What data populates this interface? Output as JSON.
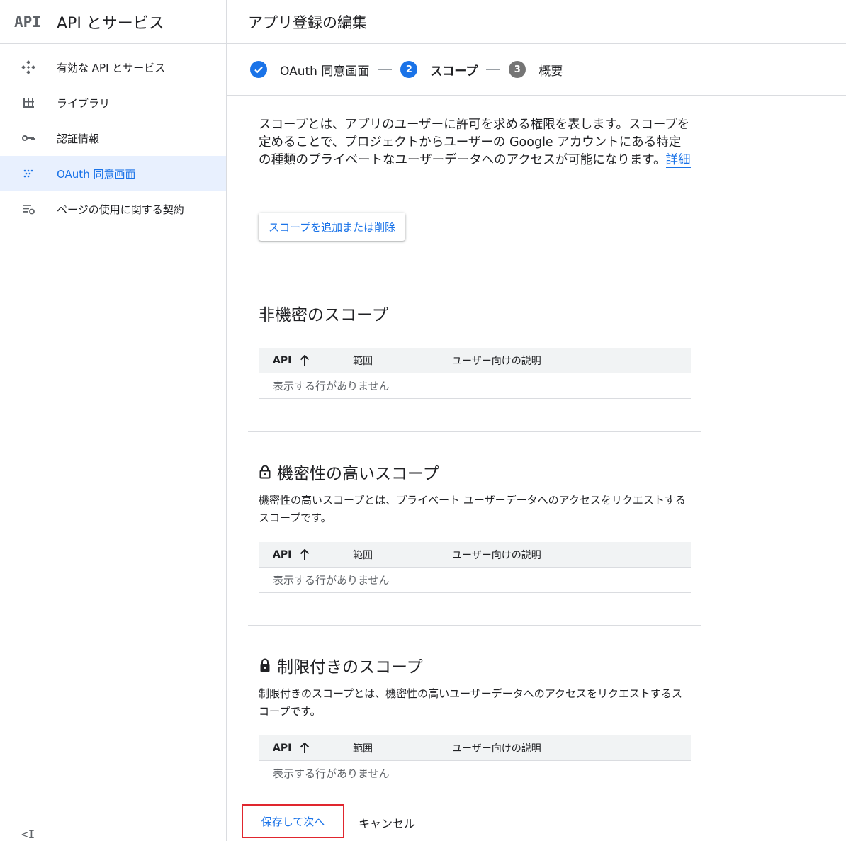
{
  "sidebar": {
    "logo": "API",
    "title": "API とサービス",
    "items": [
      {
        "label": "有効な API とサービス",
        "icon": "api-diamond-icon"
      },
      {
        "label": "ライブラリ",
        "icon": "library-icon"
      },
      {
        "label": "認証情報",
        "icon": "key-icon"
      },
      {
        "label": "OAuth 同意画面",
        "icon": "consent-dots-icon",
        "active": true
      },
      {
        "label": "ページの使用に関する契約",
        "icon": "settings-list-icon"
      }
    ],
    "collapse": "<I"
  },
  "header": {
    "title": "アプリ登録の編集"
  },
  "stepper": {
    "steps": [
      {
        "label": "OAuth 同意画面",
        "state": "done"
      },
      {
        "number": "2",
        "label": "スコープ",
        "state": "current"
      },
      {
        "number": "3",
        "label": "概要",
        "state": "pending"
      }
    ]
  },
  "intro": {
    "text": "スコープとは、アプリのユーザーに許可を求める権限を表します。スコープを定めることで、プロジェクトからユーザーの Google アカウントにある特定の種類のプライベートなユーザーデータへのアクセスが可能になります。",
    "link": "詳細"
  },
  "add_button": "スコープを追加または削除",
  "table_headers": {
    "api": "API",
    "range": "範囲",
    "desc": "ユーザー向けの説明"
  },
  "empty_text": "表示する行がありません",
  "sections": {
    "nonsensitive": {
      "title": "非機密のスコープ"
    },
    "sensitive": {
      "title": "機密性の高いスコープ",
      "desc": "機密性の高いスコープとは、プライベート ユーザーデータへのアクセスをリクエストするスコープです。"
    },
    "restricted": {
      "title": "制限付きのスコープ",
      "desc": "制限付きのスコープとは、機密性の高いユーザーデータへのアクセスをリクエストするスコープです。"
    }
  },
  "footer": {
    "save": "保存して次へ",
    "cancel": "キャンセル"
  },
  "colors": {
    "accent": "#1a73e8",
    "highlight_border": "#e0262e",
    "active_bg": "#e8f0fe"
  }
}
